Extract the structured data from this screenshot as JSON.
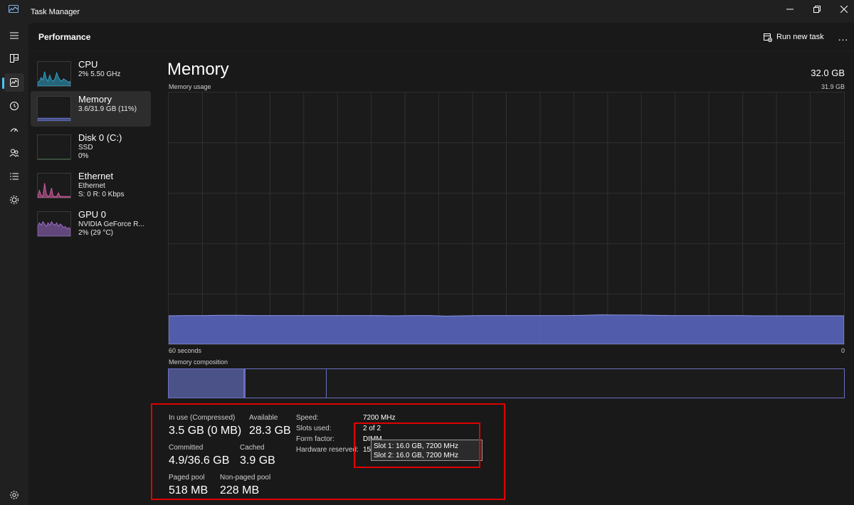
{
  "window": {
    "title": "Task Manager",
    "controls": [
      "minimize",
      "maximize",
      "close"
    ]
  },
  "rail": {
    "items": [
      {
        "icon": "hamburger-icon"
      },
      {
        "icon": "processes-icon"
      },
      {
        "icon": "performance-icon",
        "active": true
      },
      {
        "icon": "app-history-icon"
      },
      {
        "icon": "startup-apps-icon"
      },
      {
        "icon": "users-icon"
      },
      {
        "icon": "details-icon"
      },
      {
        "icon": "services-icon"
      },
      {
        "icon": "settings-icon"
      }
    ]
  },
  "header": {
    "page_title": "Performance",
    "run_new_task": "Run new task",
    "more": "..."
  },
  "devices": [
    {
      "name": "CPU",
      "line1": "2% 5.50 GHz",
      "line2": "",
      "color": "#2fa3c9",
      "usage": [
        0.15,
        0.2,
        0.35,
        0.25,
        0.6,
        0.3,
        0.2,
        0.45,
        0.25,
        0.2,
        0.3,
        0.55,
        0.35,
        0.25,
        0.2,
        0.3,
        0.25,
        0.2,
        0.15,
        0.2
      ],
      "selected": false
    },
    {
      "name": "Memory",
      "line1": "3.6/31.9 GB (11%)",
      "line2": "",
      "color": "#6a78d9",
      "usage": [
        0.11,
        0.11,
        0.11,
        0.11,
        0.11,
        0.11,
        0.11,
        0.11,
        0.11,
        0.11,
        0.11,
        0.11,
        0.11,
        0.11,
        0.11,
        0.11,
        0.11,
        0.11,
        0.11,
        0.11
      ],
      "selected": true
    },
    {
      "name": "Disk 0 (C:)",
      "line1": "SSD",
      "line2": "0%",
      "color": "#5fa75f",
      "usage": [
        0,
        0,
        0,
        0,
        0,
        0,
        0,
        0,
        0,
        0,
        0,
        0,
        0,
        0,
        0,
        0,
        0,
        0,
        0,
        0
      ],
      "selected": false
    },
    {
      "name": "Ethernet",
      "line1": "Ethernet",
      "line2": "S: 0 R: 0 Kbps",
      "color": "#d25ca0",
      "usage": [
        0.05,
        0.3,
        0.1,
        0.05,
        0.6,
        0.15,
        0.05,
        0.1,
        0.4,
        0.05,
        0.05,
        0.05,
        0.2,
        0.05,
        0.05,
        0.05,
        0.05,
        0.05,
        0.05,
        0.05
      ],
      "selected": false
    },
    {
      "name": "GPU 0",
      "line1": "NVIDIA GeForce R...",
      "line2": "2% (29 °C)",
      "color": "#9b6bc9",
      "usage": [
        0.4,
        0.55,
        0.45,
        0.6,
        0.5,
        0.4,
        0.55,
        0.45,
        0.6,
        0.5,
        0.45,
        0.55,
        0.4,
        0.5,
        0.45,
        0.35,
        0.4,
        0.3,
        0.35,
        0.3
      ],
      "selected": false
    }
  ],
  "memory": {
    "title": "Memory",
    "total": "32.0 GB",
    "usage_label": "Memory usage",
    "usage_max": "31.9 GB",
    "axis_left": "60 seconds",
    "axis_right": "0",
    "composition_label": "Memory composition",
    "graph_color": "#5b67c4",
    "usage_history": [
      0.113,
      0.114,
      0.114,
      0.115,
      0.115,
      0.114,
      0.114,
      0.114,
      0.114,
      0.114,
      0.114,
      0.114,
      0.114,
      0.113,
      0.114,
      0.114,
      0.112,
      0.113,
      0.114,
      0.114,
      0.114,
      0.114,
      0.114,
      0.114,
      0.115,
      0.117,
      0.116,
      0.116,
      0.115,
      0.114,
      0.114,
      0.114,
      0.114,
      0.114,
      0.113,
      0.113,
      0.113,
      0.113,
      0.113,
      0.113
    ]
  },
  "stats": {
    "in_use_label": "In use (Compressed)",
    "in_use_value": "3.5 GB (0 MB)",
    "available_label": "Available",
    "available_value": "28.3 GB",
    "committed_label": "Committed",
    "committed_value": "4.9/36.6 GB",
    "cached_label": "Cached",
    "cached_value": "3.9 GB",
    "paged_label": "Paged pool",
    "paged_value": "518 MB",
    "nonpaged_label": "Non-paged pool",
    "nonpaged_value": "228 MB"
  },
  "details": {
    "speed_label": "Speed:",
    "speed_value": "7200 MHz",
    "slots_label": "Slots used:",
    "slots_value": "2 of 2",
    "form_label": "Form factor:",
    "form_value": "DIMM",
    "reserved_label": "Hardware reserved:",
    "reserved_value": "15"
  },
  "tooltip": {
    "line1": "Slot 1: 16.0 GB, 7200 MHz",
    "line2": "Slot 2: 16.0 GB, 7200 MHz"
  }
}
